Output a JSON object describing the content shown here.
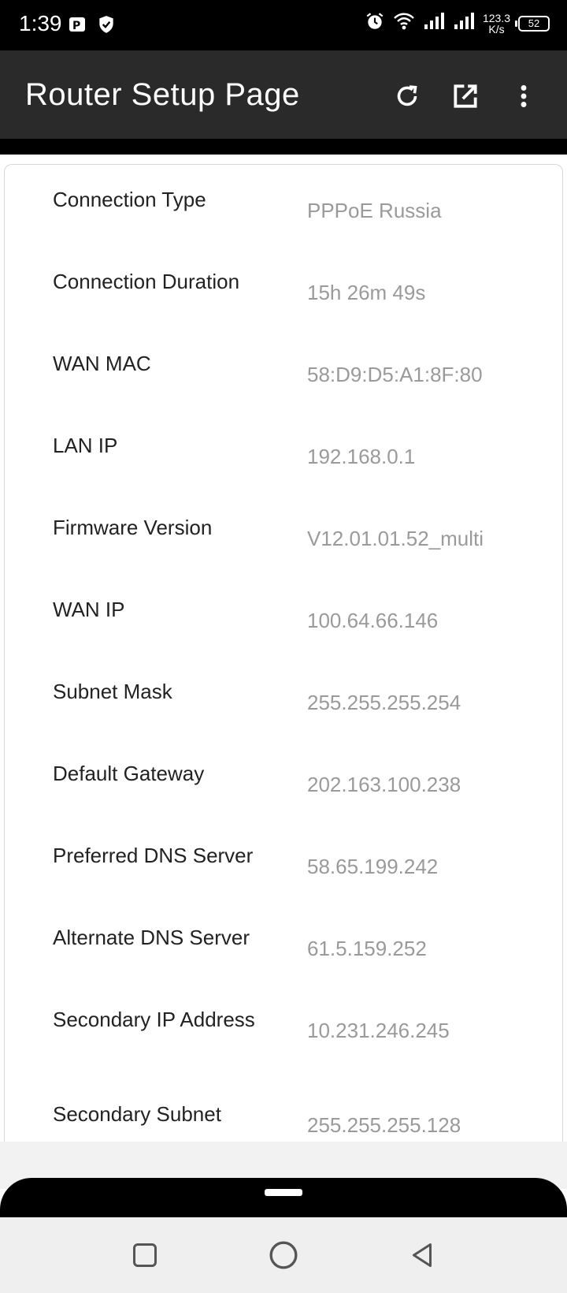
{
  "status_bar": {
    "time": "1:39",
    "network_speed_value": "123.3",
    "network_speed_unit": "K/s",
    "battery_level": "52"
  },
  "app_bar": {
    "title": "Router Setup Page",
    "icons": [
      "refresh-icon",
      "open-external-icon",
      "more-vert-icon"
    ]
  },
  "router_info": [
    {
      "label": "Connection Type",
      "value": "PPPoE Russia"
    },
    {
      "label": "Connection Duration",
      "value": "15h 26m 49s"
    },
    {
      "label": "WAN MAC",
      "value": "58:D9:D5:A1:8F:80"
    },
    {
      "label": "LAN IP",
      "value": "192.168.0.1"
    },
    {
      "label": "Firmware Version",
      "value": "V12.01.01.52_multi"
    },
    {
      "label": "WAN IP",
      "value": "100.64.66.146"
    },
    {
      "label": "Subnet Mask",
      "value": "255.255.255.254"
    },
    {
      "label": "Default Gateway",
      "value": "202.163.100.238"
    },
    {
      "label": "Preferred DNS Server",
      "value": "58.65.199.242"
    },
    {
      "label": "Alternate DNS Server",
      "value": "61.5.159.252"
    },
    {
      "label": "Secondary IP Address",
      "value": "10.231.246.245"
    },
    {
      "label": "Secondary Subnet",
      "value": "255.255.255.128"
    }
  ],
  "navigation": {
    "icons": [
      "recent-apps-icon",
      "home-icon",
      "back-icon"
    ]
  }
}
